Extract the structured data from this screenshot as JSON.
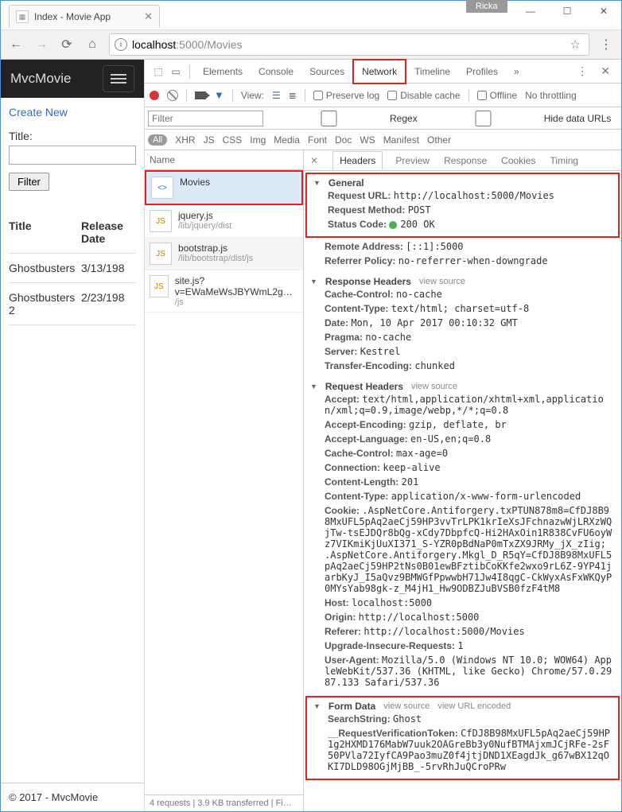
{
  "window": {
    "user_tag": "Ricka",
    "tab_title": "Index - Movie App"
  },
  "omnibox": {
    "display": "localhost:5000/Movies",
    "host": "localhost",
    "port": ":5000",
    "path": "/Movies"
  },
  "app": {
    "brand": "MvcMovie",
    "create_link": "Create New",
    "title_label": "Title:",
    "filter_btn": "Filter",
    "table": {
      "headers": [
        "Title",
        "Release Date"
      ],
      "rows": [
        {
          "title": "Ghostbusters",
          "date": "3/13/198"
        },
        {
          "title": "Ghostbusters 2",
          "date": "2/23/198"
        }
      ]
    },
    "footer": "© 2017 - MvcMovie"
  },
  "devtools": {
    "tabs": [
      "Elements",
      "Console",
      "Sources",
      "Network",
      "Timeline",
      "Profiles"
    ],
    "active_tab": "Network",
    "view_label": "View:",
    "preserve_log": "Preserve log",
    "disable_cache": "Disable cache",
    "offline": "Offline",
    "throttling": "No throttling",
    "filter_placeholder": "Filter",
    "regex": "Regex",
    "hide_data": "Hide data URLs",
    "types": [
      "All",
      "XHR",
      "JS",
      "CSS",
      "Img",
      "Media",
      "Font",
      "Doc",
      "WS",
      "Manifest",
      "Other"
    ],
    "name_hdr": "Name",
    "requests": [
      {
        "name": "Movies",
        "sub": "",
        "icon": "<>",
        "sel": true,
        "hl": true
      },
      {
        "name": "jquery.js",
        "sub": "/lib/jquery/dist",
        "icon": "JS"
      },
      {
        "name": "bootstrap.js",
        "sub": "/lib/bootstrap/dist/js",
        "icon": "JS"
      },
      {
        "name": "site.js?v=EWaMeWsJBYWmL2g…",
        "sub": "/js",
        "icon": "JS"
      }
    ],
    "status_line": "4 requests  |  3.9 KB transferred  |  Fi…",
    "detail_tabs": [
      "Headers",
      "Preview",
      "Response",
      "Cookies",
      "Timing"
    ],
    "general": {
      "title": "General",
      "url_k": "Request URL:",
      "url_v": "http://localhost:5000/Movies",
      "method_k": "Request Method:",
      "method_v": "POST",
      "status_k": "Status Code:",
      "status_v": "200 OK",
      "remote_k": "Remote Address:",
      "remote_v": "[::1]:5000",
      "ref_k": "Referrer Policy:",
      "ref_v": "no-referrer-when-downgrade"
    },
    "resp_headers": {
      "title": "Response Headers",
      "view_source": "view source",
      "items": [
        [
          "Cache-Control:",
          "no-cache"
        ],
        [
          "Content-Type:",
          "text/html; charset=utf-8"
        ],
        [
          "Date:",
          "Mon, 10 Apr 2017 00:10:32 GMT"
        ],
        [
          "Pragma:",
          "no-cache"
        ],
        [
          "Server:",
          "Kestrel"
        ],
        [
          "Transfer-Encoding:",
          "chunked"
        ]
      ]
    },
    "req_headers": {
      "title": "Request Headers",
      "view_source": "view source",
      "items": [
        [
          "Accept:",
          "text/html,application/xhtml+xml,application/xml;q=0.9,image/webp,*/*;q=0.8"
        ],
        [
          "Accept-Encoding:",
          "gzip, deflate, br"
        ],
        [
          "Accept-Language:",
          "en-US,en;q=0.8"
        ],
        [
          "Cache-Control:",
          "max-age=0"
        ],
        [
          "Connection:",
          "keep-alive"
        ],
        [
          "Content-Length:",
          "201"
        ],
        [
          "Content-Type:",
          "application/x-www-form-urlencoded"
        ],
        [
          "Cookie:",
          ".AspNetCore.Antiforgery.txPTUN878m8=CfDJ8B98MxUFL5pAq2aeCj59HP3vvTrLPK1krIeXsJFchnazwWjLRXzWQjTw-tsEJDQr8bQg-xCdy7DbpfcQ-Hi2HAxOin1R838CvFU6oyWz7VIKmiKjUuXI371_S-YZR0pBdNaP0mTxZX9JRMy_jX_zIig; .AspNetCore.Antiforgery.Mkgl_D_R5qY=CfDJ8B98MxUFL5pAq2aeCj59HP2tNs0B01ewBFztibCoKKfe2wxo9rL6Z-9YP41jarbKyJ_I5aQvz9BMWGfPpwwbH71Jw4I8qgC-CkWyxAsFxWKQyP0MYsYab98gk-z_M4jH1_Hw9ODBZJuBVSB0fzF4tM8"
        ],
        [
          "Host:",
          "localhost:5000"
        ],
        [
          "Origin:",
          "http://localhost:5000"
        ],
        [
          "Referer:",
          "http://localhost:5000/Movies"
        ],
        [
          "Upgrade-Insecure-Requests:",
          "1"
        ],
        [
          "User-Agent:",
          "Mozilla/5.0 (Windows NT 10.0; WOW64) AppleWebKit/537.36 (KHTML, like Gecko) Chrome/57.0.2987.133 Safari/537.36"
        ]
      ]
    },
    "form_data": {
      "title": "Form Data",
      "view_source": "view source",
      "view_url": "view URL encoded",
      "items": [
        [
          "SearchString:",
          "Ghost"
        ],
        [
          "__RequestVerificationToken:",
          "CfDJ8B98MxUFL5pAq2aeCj59HP1g2HXMD176MabW7uuk2OAGreBb3y0NufBTMAjxmJCjRFe-2sF50PVla72IyfCA9Pao3muZ0f4jtjDND1XEagdJk_g67wBX12qOKI7DLD98OGjMjBB_-5rvRhJuQCroPRw"
        ]
      ]
    }
  }
}
